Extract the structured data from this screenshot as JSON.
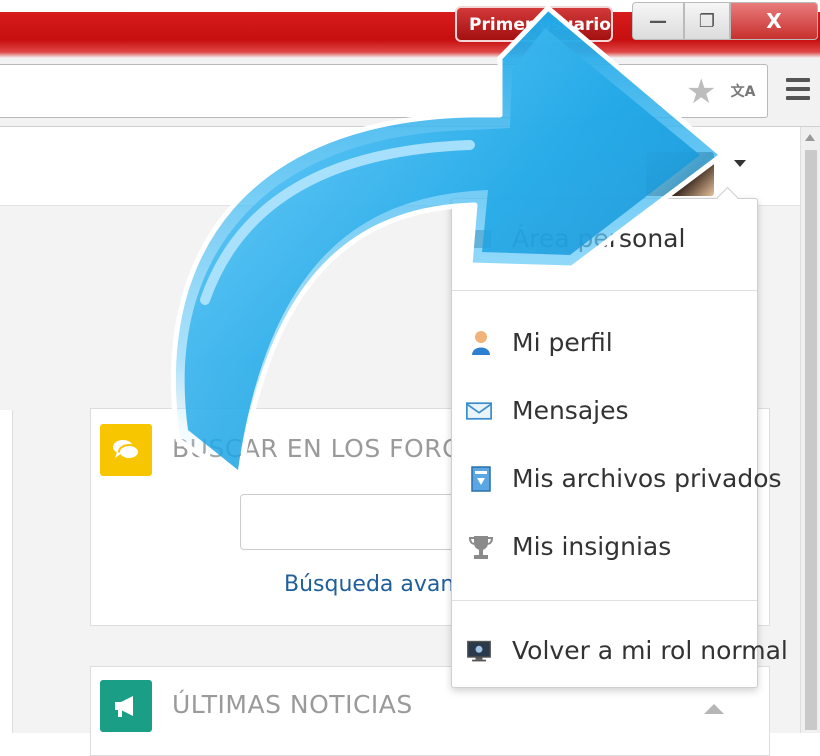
{
  "window": {
    "profile_button_label": "Primer usuario",
    "minimize_symbol": "—",
    "restore_symbol": "❐",
    "close_symbol": "X"
  },
  "toolbar": {
    "star_icon": "star-icon",
    "translate_icon": "translate-icon",
    "translate_glyph": "文A",
    "menu_icon": "menu-icon"
  },
  "user_menu": {
    "avatar": "avatar",
    "items": [
      {
        "label": "Área personal",
        "icon": "dashboard-icon"
      },
      {
        "label": "Mi perfil",
        "icon": "user-icon"
      },
      {
        "label": "Mensajes",
        "icon": "envelope-icon"
      },
      {
        "label": "Mis archivos privados",
        "icon": "file-icon"
      },
      {
        "label": "Mis insignias",
        "icon": "trophy-icon"
      },
      {
        "label": "Volver a mi rol normal",
        "icon": "monitor-icon"
      }
    ]
  },
  "blocks": {
    "search_forums": {
      "title": "BUSCAR EN LOS FOROS",
      "advanced_link": "Búsqueda avanzada",
      "input_value": ""
    },
    "latest_news": {
      "title": "ÚLTIMAS NOTICIAS"
    }
  },
  "colors": {
    "title_bar": "#c70f0f",
    "arrow": "#1ea7e6",
    "search_block_icon": "#f7c600",
    "news_block_icon": "#1a9e86",
    "link": "#1f5f9a"
  }
}
